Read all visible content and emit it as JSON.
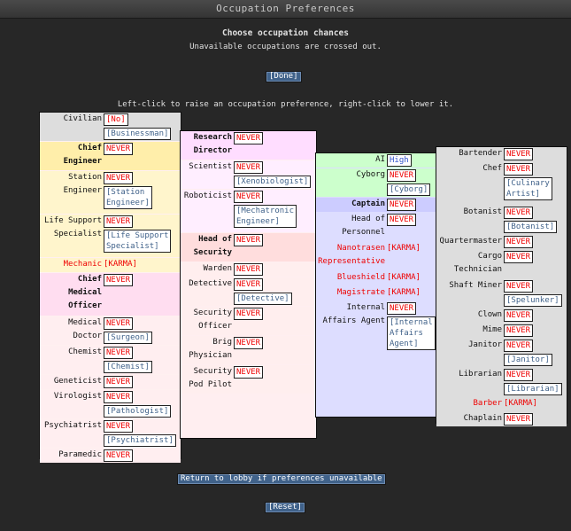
{
  "window_title": "Occupation Preferences",
  "heading": "Choose occupation chances",
  "subheading": "Unavailable occupations are crossed out.",
  "done_label": "[Done]",
  "instructions": "Left-click to raise an occupation preference, right-click to lower it.",
  "return_label": "Return to lobby if preferences unavailable",
  "reset_label": "[Reset]",
  "columns": [
    {
      "jobs": [
        {
          "name": "Civilian",
          "bg": "#dddddd",
          "h": 32,
          "pref": "[No]",
          "pref_class": "no",
          "alt": "[Businessman]"
        },
        {
          "name": "Chief\nEngineer",
          "bg": "#ffeeaa",
          "h": 32,
          "bold": true,
          "pref": "NEVER"
        },
        {
          "name": "Station\nEngineer",
          "bg": "#fff5cc",
          "h": 48,
          "pref": "NEVER",
          "alt": "[Station\nEngineer]"
        },
        {
          "name": "Life Support\nSpecialist",
          "bg": "#fff5cc",
          "h": 48,
          "pref": "NEVER",
          "alt": "[Life Support\nSpecialist]"
        },
        {
          "name": "Mechanic",
          "bg": "#fff5cc",
          "h": 16,
          "karma_job": true,
          "pref": "[KARMA]",
          "pref_class": "karma"
        },
        {
          "name": "Chief\nMedical\nOfficer",
          "bg": "#ffddf0",
          "h": 48,
          "bold": true,
          "pref": "NEVER"
        },
        {
          "name": "Medical\nDoctor",
          "bg": "#ffeef0",
          "h": 32,
          "pref": "NEVER",
          "alt": "[Surgeon]"
        },
        {
          "name": "Chemist",
          "bg": "#ffeef0",
          "h": 32,
          "pref": "NEVER",
          "alt": "[Chemist]"
        },
        {
          "name": "Geneticist",
          "bg": "#ffeef0",
          "h": 16,
          "pref": "NEVER"
        },
        {
          "name": "Virologist",
          "bg": "#ffeef0",
          "h": 32,
          "pref": "NEVER",
          "alt": "[Pathologist]"
        },
        {
          "name": "Psychiatrist",
          "bg": "#ffeef0",
          "h": 32,
          "pref": "NEVER",
          "alt": "[Psychiatrist]"
        },
        {
          "name": "Paramedic",
          "bg": "#ffeef0",
          "h": 16,
          "pref": "NEVER"
        }
      ]
    },
    {
      "jobs": [
        {
          "name": "Research\nDirector",
          "bg": "#ffddff",
          "h": 32,
          "bold": true,
          "pref": "NEVER"
        },
        {
          "name": "Scientist",
          "bg": "#ffeeff",
          "h": 32,
          "pref": "NEVER",
          "alt": "[Xenobiologist]"
        },
        {
          "name": "Roboticist",
          "bg": "#ffeeff",
          "h": 48,
          "pref": "NEVER",
          "alt": "[Mechatronic\nEngineer]"
        },
        {
          "name": "Head of\nSecurity",
          "bg": "#ffdddd",
          "h": 32,
          "bold": true,
          "pref": "NEVER"
        },
        {
          "name": "Warden",
          "bg": "#ffeeee",
          "h": 16,
          "pref": "NEVER"
        },
        {
          "name": "Detective",
          "bg": "#ffeeee",
          "h": 32,
          "pref": "NEVER",
          "alt": "[Detective]"
        },
        {
          "name": "Security\nOfficer",
          "bg": "#ffeeee",
          "h": 32,
          "pref": "NEVER"
        },
        {
          "name": "Brig\nPhysician",
          "bg": "#ffeeee",
          "h": 32,
          "pref": "NEVER"
        },
        {
          "name": "Security\nPod Pilot",
          "bg": "#ffeeee",
          "h": 32,
          "pref": "NEVER"
        }
      ]
    },
    {
      "jobs": [
        {
          "name": "AI",
          "bg": "#ccffcc",
          "h": 16,
          "pref": "High",
          "pref_class": "high"
        },
        {
          "name": "Cyborg",
          "bg": "#ccffcc",
          "h": 32,
          "pref": "NEVER",
          "alt": "[Cyborg]"
        },
        {
          "name": "Captain",
          "bg": "#ccccff",
          "h": 16,
          "bold": true,
          "pref": "NEVER"
        },
        {
          "name": "Head of\nPersonnel",
          "bg": "#ddddff",
          "h": 32,
          "pref": "NEVER"
        },
        {
          "name": "Nanotrasen\nRepresentative",
          "bg": "#ddddff",
          "h": 32,
          "karma_job": true,
          "pref": "[KARMA]",
          "pref_class": "karma"
        },
        {
          "name": "Blueshield",
          "bg": "#ddddff",
          "h": 16,
          "karma_job": true,
          "pref": "[KARMA]",
          "pref_class": "karma"
        },
        {
          "name": "Magistrate",
          "bg": "#ddddff",
          "h": 16,
          "karma_job": true,
          "pref": "[KARMA]",
          "pref_class": "karma"
        },
        {
          "name": "Internal\nAffairs Agent",
          "bg": "#ddddff",
          "h": 64,
          "pref": "NEVER",
          "alt": "[Internal\nAffairs\nAgent]"
        }
      ]
    },
    {
      "jobs": [
        {
          "name": "Bartender",
          "bg": "#dddddd",
          "h": 16,
          "pref": "NEVER"
        },
        {
          "name": "Chef",
          "bg": "#dddddd",
          "h": 48,
          "pref": "NEVER",
          "alt": "[Culinary\nArtist]"
        },
        {
          "name": "Botanist",
          "bg": "#dddddd",
          "h": 32,
          "pref": "NEVER",
          "alt": "[Botanist]"
        },
        {
          "name": "Quartermaster",
          "bg": "#dddddd",
          "h": 16,
          "pref": "NEVER"
        },
        {
          "name": "Cargo\nTechnician",
          "bg": "#dddddd",
          "h": 32,
          "pref": "NEVER"
        },
        {
          "name": "Shaft Miner",
          "bg": "#dddddd",
          "h": 32,
          "pref": "NEVER",
          "alt": "[Spelunker]"
        },
        {
          "name": "Clown",
          "bg": "#dddddd",
          "h": 16,
          "pref": "NEVER"
        },
        {
          "name": "Mime",
          "bg": "#dddddd",
          "h": 16,
          "pref": "NEVER"
        },
        {
          "name": "Janitor",
          "bg": "#dddddd",
          "h": 32,
          "pref": "NEVER",
          "alt": "[Janitor]"
        },
        {
          "name": "Librarian",
          "bg": "#dddddd",
          "h": 32,
          "pref": "NEVER",
          "alt": "[Librarian]"
        },
        {
          "name": "Barber",
          "bg": "#dddddd",
          "h": 16,
          "karma_job": true,
          "pref": "[KARMA]",
          "pref_class": "karma"
        },
        {
          "name": "Chaplain",
          "bg": "#dddddd",
          "h": 16,
          "pref": "NEVER"
        }
      ]
    }
  ]
}
